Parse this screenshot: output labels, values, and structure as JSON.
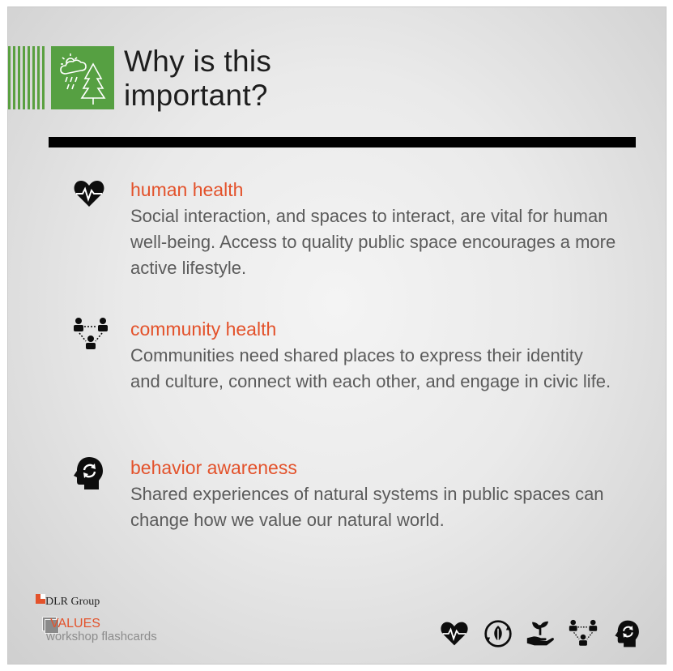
{
  "title": {
    "line1": "Why is this",
    "line2": "important?",
    "icon": "weather-forest-icon",
    "accent_color": "#56a042"
  },
  "items": [
    {
      "heading": "human health",
      "body": "Social interaction, and spaces to interact, are vital for human well-being. Access to quality public space encourages a more active lifestyle.",
      "icon": "heart-pulse-icon"
    },
    {
      "heading": "community health",
      "body": "Communities need shared places to express their identity and culture, connect with each other, and engage in civic life.",
      "icon": "community-network-icon"
    },
    {
      "heading": "behavior awareness",
      "body": "Shared experiences of natural systems in public spaces can change how we value our natural world.",
      "icon": "head-cycle-icon"
    }
  ],
  "branding": {
    "company": "DLR Group",
    "values": "VALUES",
    "subtitle": "workshop flashcards"
  },
  "footer_icons": [
    "heart-pulse-icon",
    "recycle-leaf-icon",
    "hand-sprout-icon",
    "community-network-icon",
    "head-cycle-icon"
  ],
  "colors": {
    "heading": "#e3522b",
    "body": "#5b5b5b",
    "rule": "#000000"
  }
}
